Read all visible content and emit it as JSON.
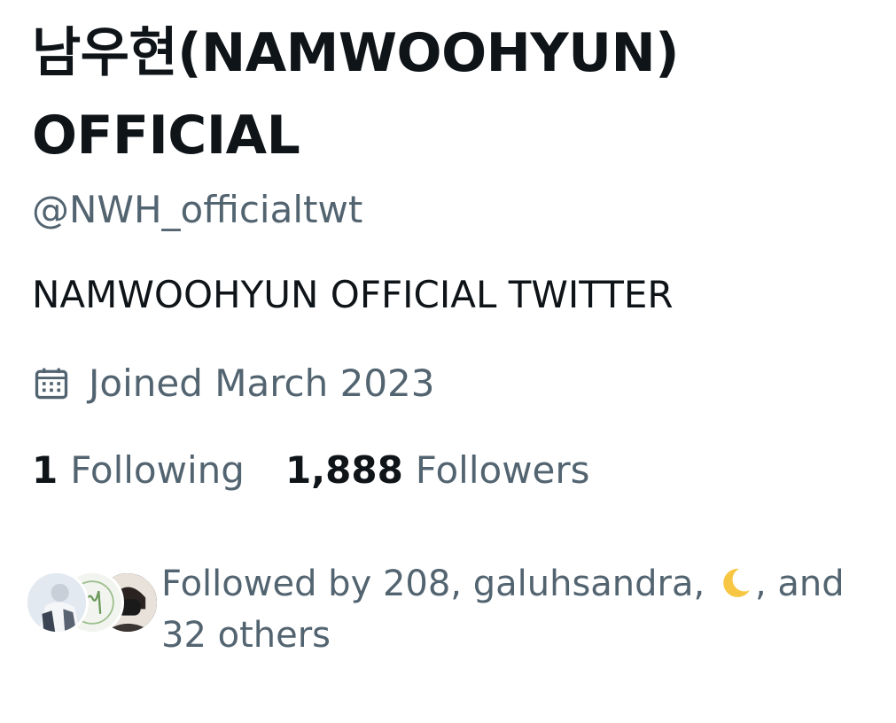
{
  "profile": {
    "display_name_line1": "남우현(NAMWOOHYUN)",
    "display_name_line2": "OFFICIAL",
    "handle": "@NWH_officialtwt",
    "bio": "NAMWOOHYUN OFFICIAL TWITTER",
    "joined": "Joined March 2023",
    "joined_icon": "calendar-icon"
  },
  "stats": {
    "following_count": "1",
    "following_label": "Following",
    "followers_count": "1,888",
    "followers_label": "Followers"
  },
  "followed_by": {
    "prefix": "Followed by 208, galuhsandra,",
    "emoji": "crescent-moon",
    "suffix": ", and 32 others"
  },
  "colors": {
    "primary_text": "#0f1419",
    "secondary_text": "#536471",
    "moon_yellow": "#f7c744",
    "background": "#ffffff"
  }
}
